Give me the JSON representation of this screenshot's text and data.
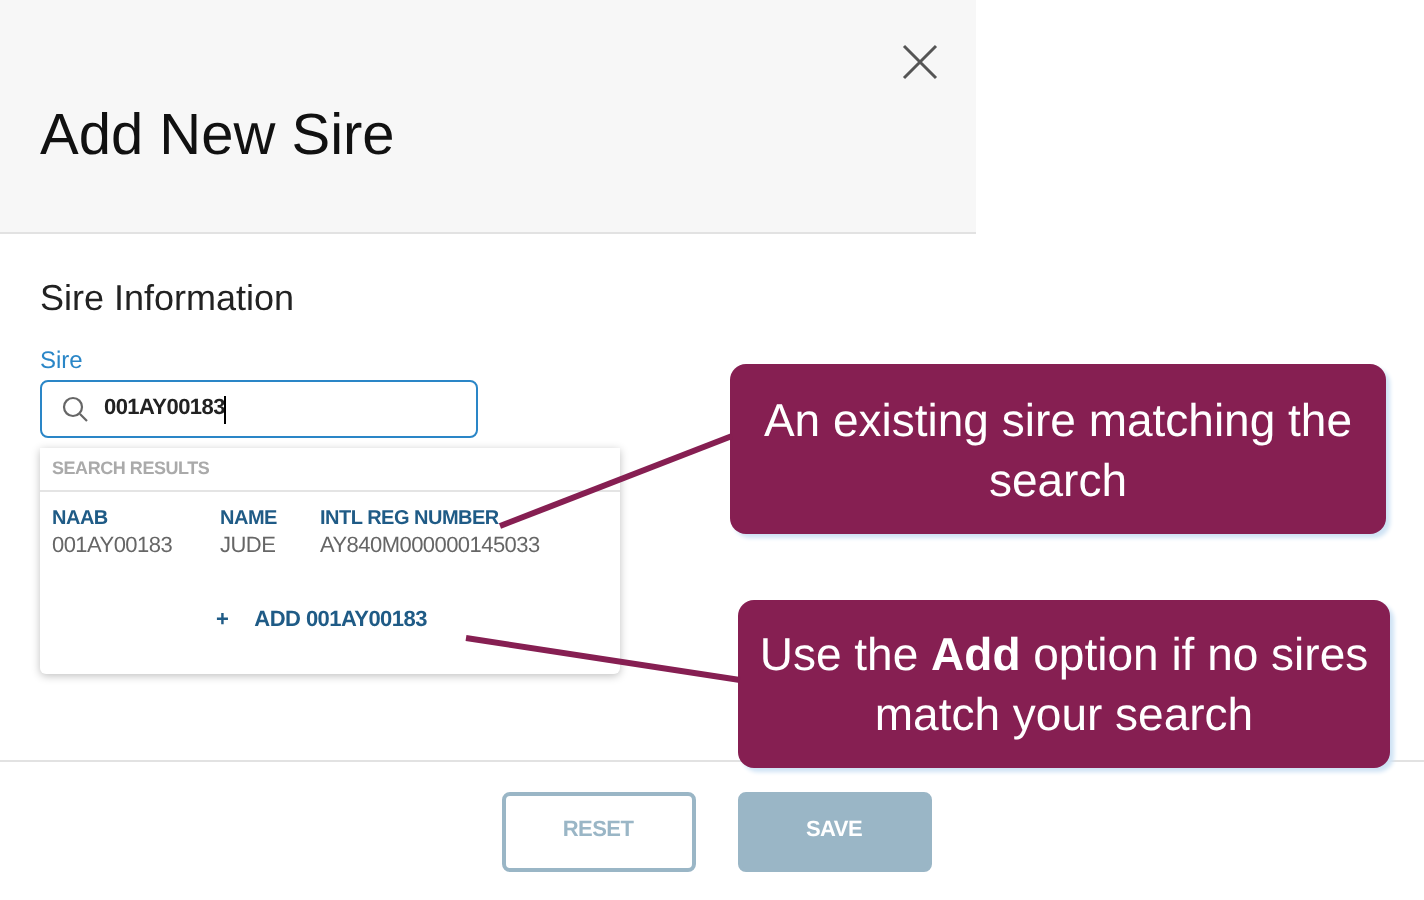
{
  "dialog": {
    "title": "Add New Sire",
    "section_title": "Sire Information"
  },
  "sire_field": {
    "label": "Sire",
    "value": "001AY00183",
    "focused": true
  },
  "search_results": {
    "header": "SEARCH RESULTS",
    "columns": [
      {
        "heading": "NAAB",
        "value": "001AY00183"
      },
      {
        "heading": "NAME",
        "value": "JUDE"
      },
      {
        "heading": "INTL REG NUMBER",
        "value": "AY840M000000145033"
      }
    ],
    "add_option": {
      "icon": "+",
      "label": "ADD 001AY00183"
    }
  },
  "buttons": [
    {
      "label": "RESET",
      "kind": "outline",
      "disabled": true
    },
    {
      "label": "SAVE",
      "kind": "filled",
      "disabled": true
    }
  ],
  "callouts": [
    {
      "text": "An existing sire matching the search"
    },
    {
      "text": "Use the **Add** option if no sires match your search"
    }
  ]
}
